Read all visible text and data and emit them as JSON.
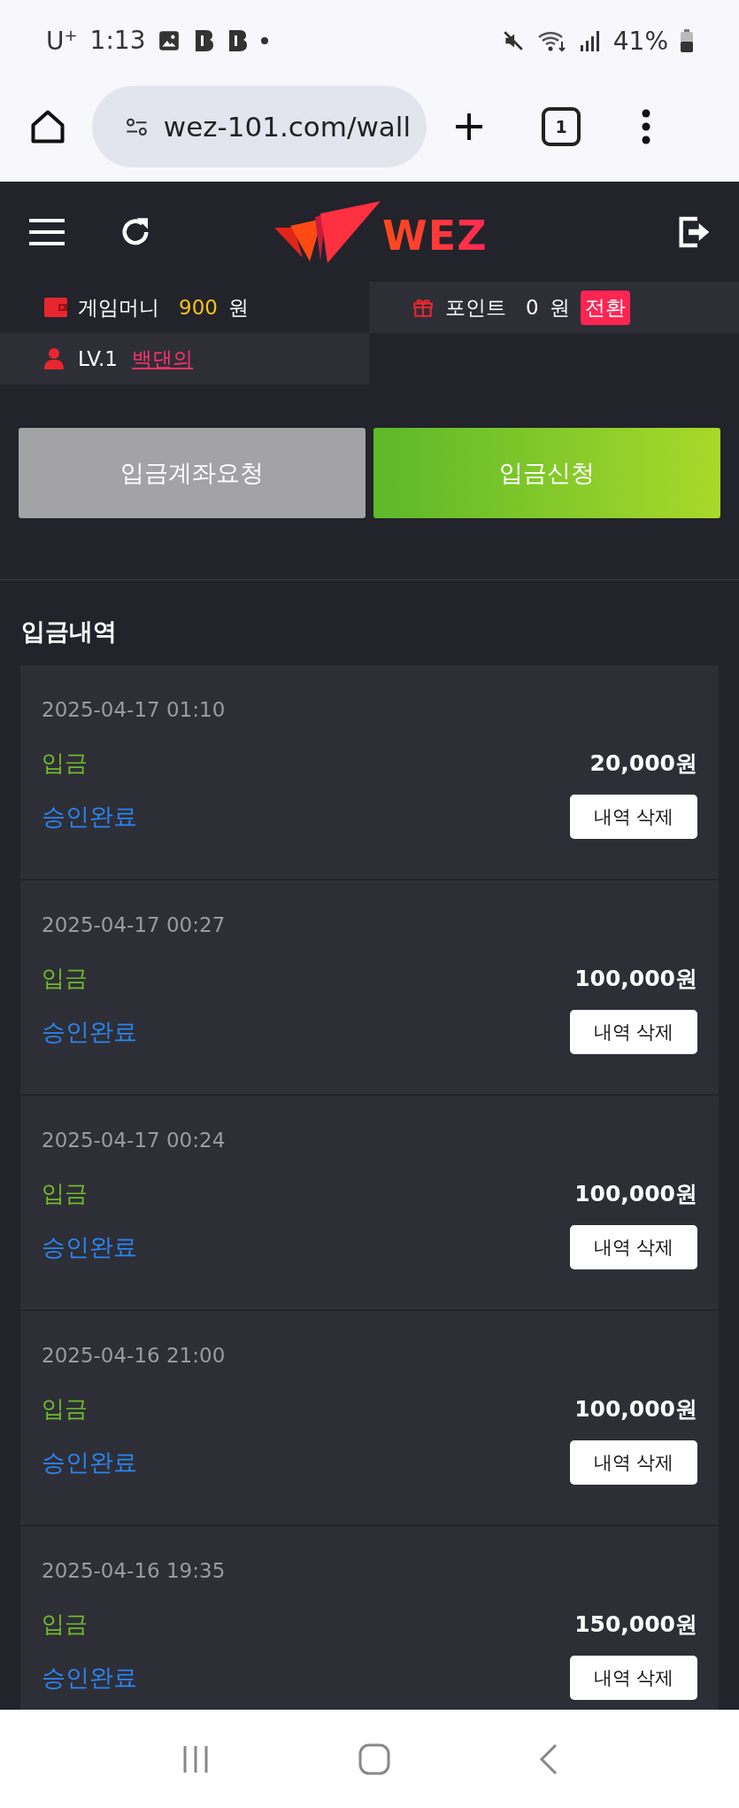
{
  "status_bar": {
    "carrier": "U$^{+}$",
    "time": "1:13",
    "battery": "41%"
  },
  "browser": {
    "url": "wez-101.com/wall",
    "tab_count": "1"
  },
  "header": {
    "logo": "WEZ"
  },
  "account": {
    "money_label": "게임머니",
    "money_value": "900",
    "money_unit": "원",
    "point_label": "포인트",
    "point_value": "0",
    "point_unit": "원",
    "convert_button": "전환",
    "level": "LV.1",
    "nickname": "백댄의"
  },
  "actions": [
    {
      "label": "입금계좌요청",
      "kind": "secondary"
    },
    {
      "label": "입금신청",
      "kind": "primary"
    }
  ],
  "history": {
    "title": "입금내역",
    "records": [
      {
        "date": "2025-04-17 01:10",
        "type": "입금",
        "amount": "20,000원",
        "status": "승인완료",
        "delete_button": "내역 삭제"
      },
      {
        "date": "2025-04-17 00:27",
        "type": "입금",
        "amount": "100,000원",
        "status": "승인완료",
        "delete_button": "내역 삭제"
      },
      {
        "date": "2025-04-17 00:24",
        "type": "입금",
        "amount": "100,000원",
        "status": "승인완료",
        "delete_button": "내역 삭제"
      },
      {
        "date": "2025-04-16 21:00",
        "type": "입금",
        "amount": "100,000원",
        "status": "승인완료",
        "delete_button": "내역 삭제"
      },
      {
        "date": "2025-04-16 19:35",
        "type": "입금",
        "amount": "150,000원",
        "status": "승인완료",
        "delete_button": "내역 삭제"
      }
    ]
  }
}
